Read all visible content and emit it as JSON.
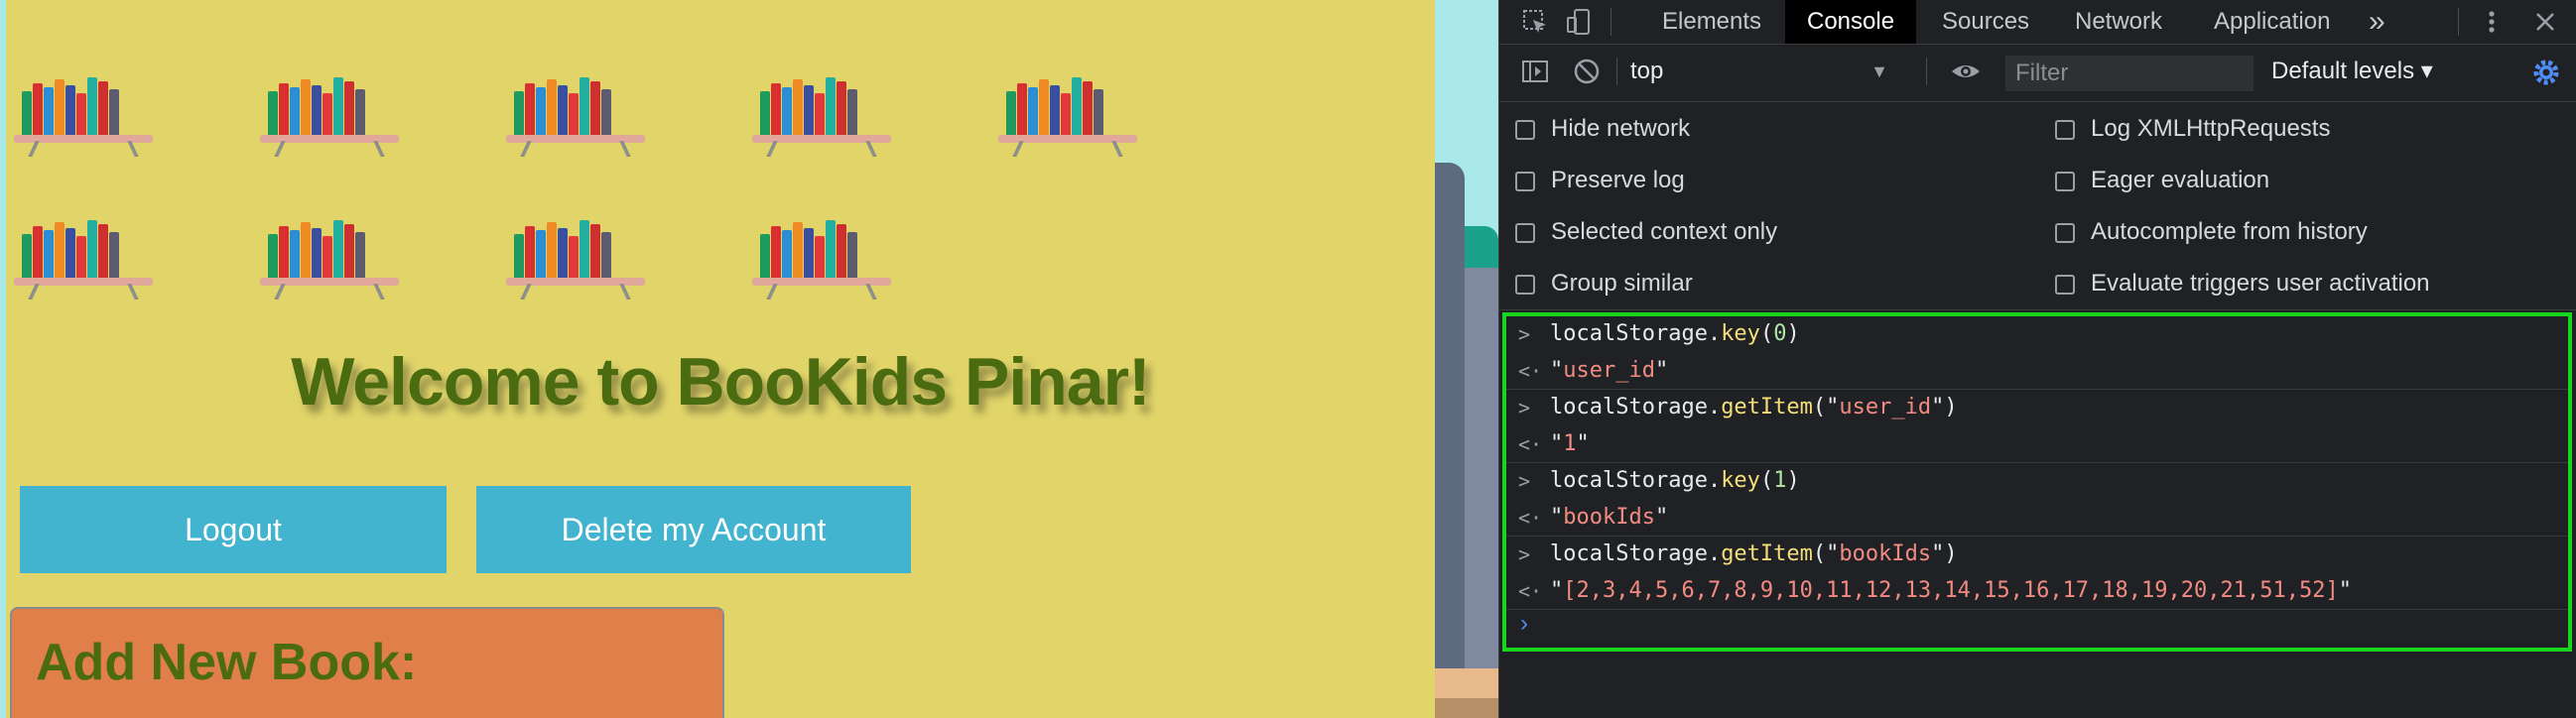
{
  "page": {
    "welcome": "Welcome to BooKids Pinar!",
    "logout_label": "Logout",
    "delete_label": "Delete my Account",
    "add_book_title": "Add New Book:",
    "shelf_row1_count": 5,
    "shelf_row2_count": 4
  },
  "devtools": {
    "tabs": [
      "Elements",
      "Console",
      "Sources",
      "Network",
      "Application"
    ],
    "active_tab": "Console",
    "more_tabs_glyph": "»",
    "context": "top",
    "filter_placeholder": "Filter",
    "levels": "Default levels ▾",
    "settings_left": [
      "Hide network",
      "Preserve log",
      "Selected context only",
      "Group similar"
    ],
    "settings_right": [
      "Log XMLHttpRequests",
      "Eager evaluation",
      "Autocomplete from history",
      "Evaluate triggers user activation"
    ],
    "console": [
      {
        "type": "input",
        "method": "key",
        "arg": "0"
      },
      {
        "type": "output",
        "value": "user_id"
      },
      {
        "type": "input",
        "method": "getItem",
        "arg": "\"user_id\""
      },
      {
        "type": "output",
        "value": "1"
      },
      {
        "type": "input",
        "method": "key",
        "arg": "1"
      },
      {
        "type": "output",
        "value": "bookIds"
      },
      {
        "type": "input",
        "method": "getItem",
        "arg": "\"bookIds\""
      },
      {
        "type": "output",
        "value": "[2,3,4,5,6,7,8,9,10,11,12,13,14,15,16,17,18,19,20,21,51,52]"
      }
    ],
    "object": "localStorage",
    "prompt_glyph": "›"
  },
  "colors": {
    "page_bg": "#e1d56a",
    "heading": "#4b6b11",
    "button": "#43b4d0",
    "panel": "#e07f4a",
    "highlight": "#18d51e"
  },
  "icons": [
    "inspect-icon",
    "device-toggle-icon",
    "sidebar-toggle-icon",
    "clear-console-icon",
    "eye-icon",
    "kebab-menu-icon",
    "close-icon",
    "settings-gear-icon",
    "bookshelf-icon"
  ]
}
